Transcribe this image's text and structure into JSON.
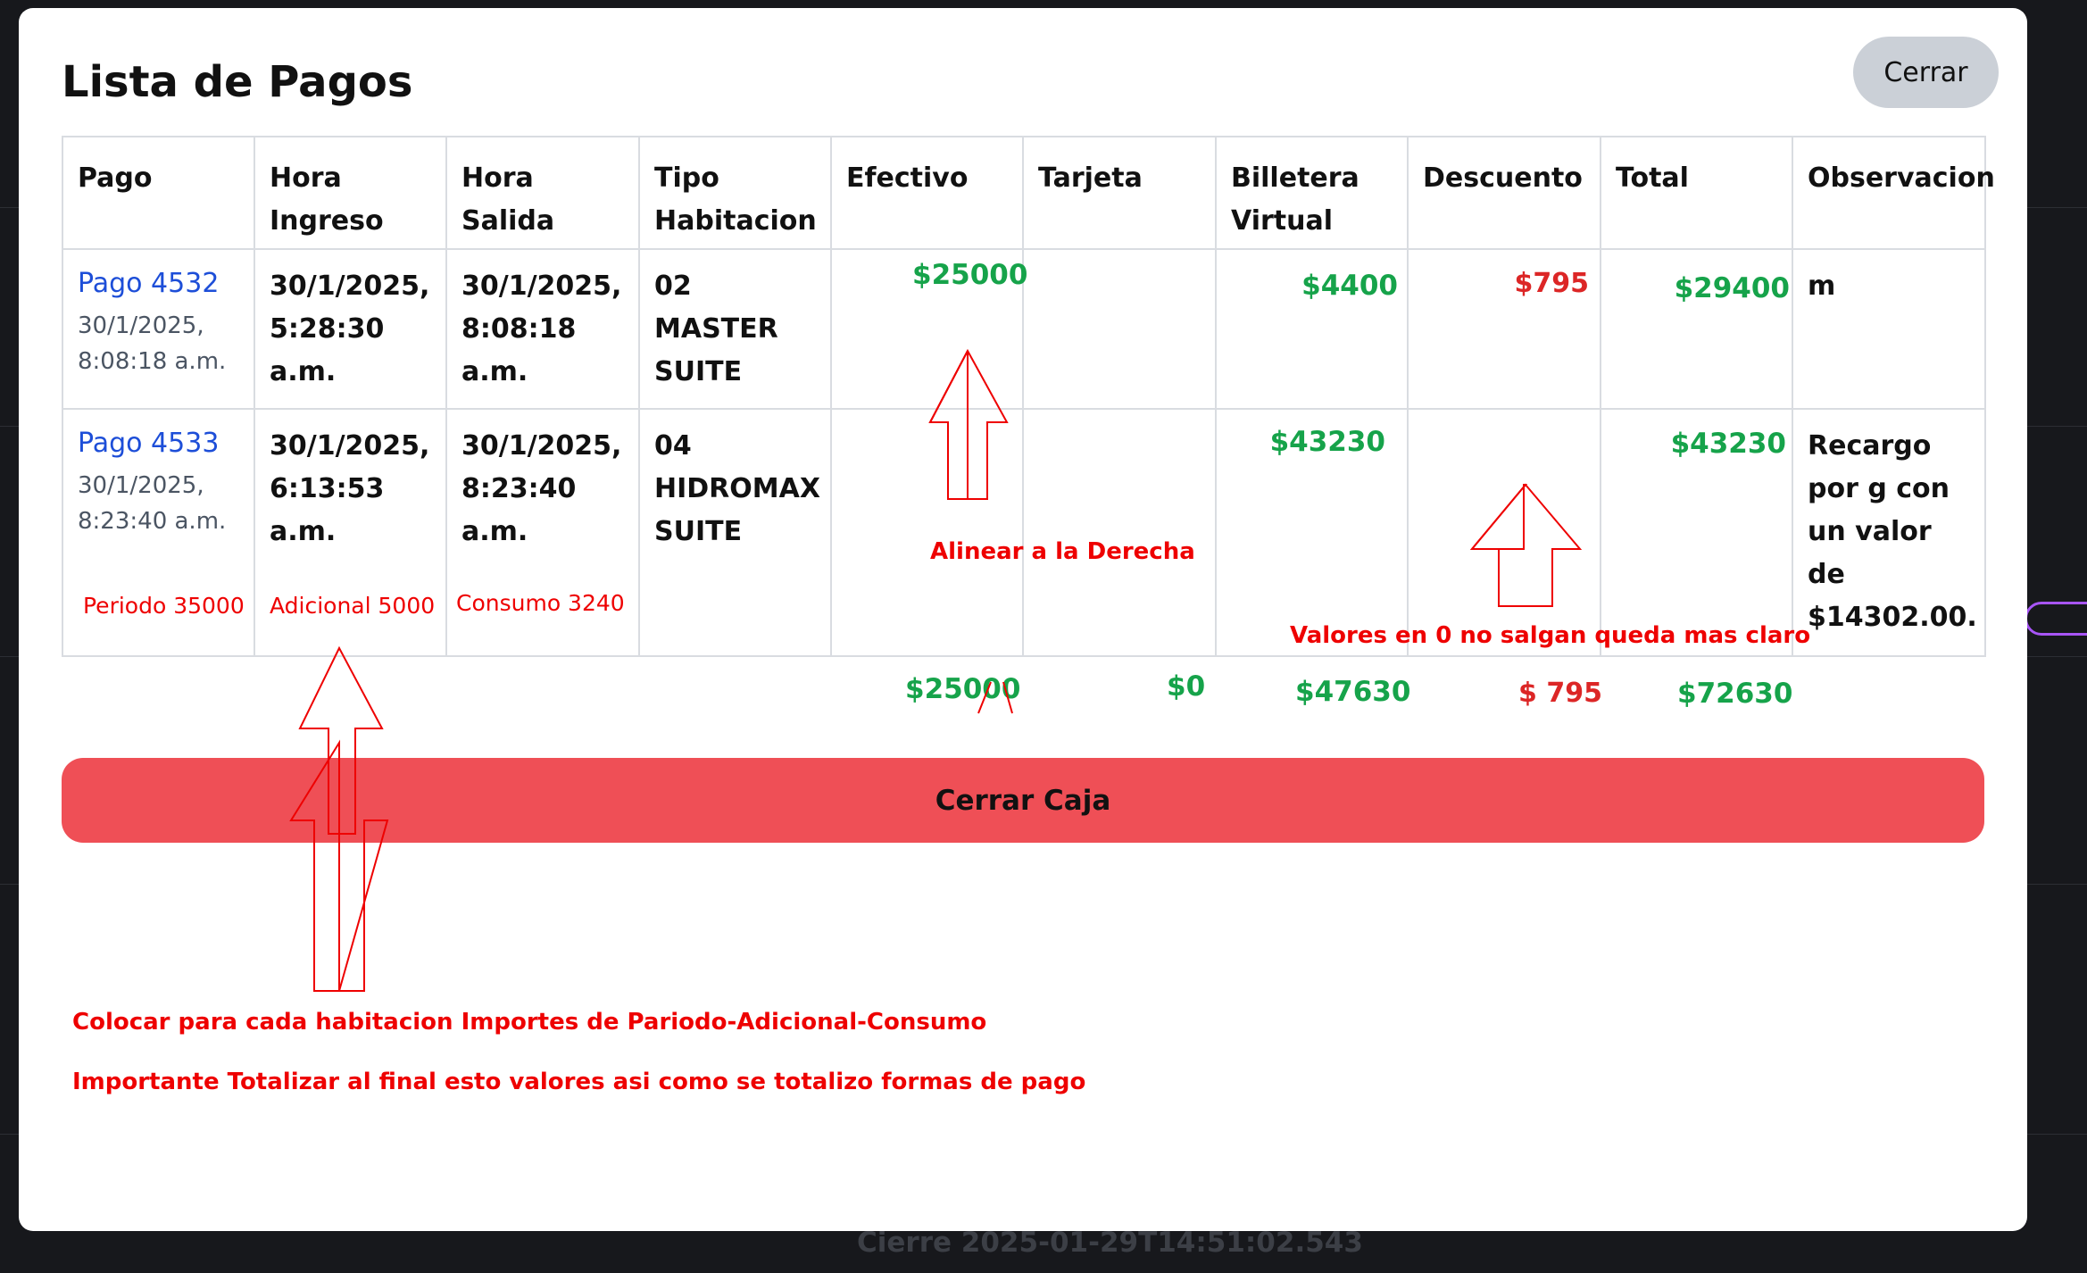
{
  "modal": {
    "title": "Lista de Pagos",
    "close_label": "Cerrar",
    "submit_label": "Cerrar Caja"
  },
  "table": {
    "headers": {
      "pago": "Pago",
      "hora_ingreso": "Hora Ingreso",
      "hora_salida": "Hora Salida",
      "tipo": "Tipo Habitacion",
      "efectivo": "Efectivo",
      "tarjeta": "Tarjeta",
      "billetera": "Billetera Virtual",
      "descuento": "Descuento",
      "total": "Total",
      "observacion": "Observacion"
    },
    "rows": [
      {
        "pago": "Pago 4532",
        "pago_fecha_1": "30/1/2025,",
        "pago_fecha_2": "8:08:18 a.m.",
        "ingreso_1": "30/1/2025,",
        "ingreso_2": "5:28:30",
        "ingreso_3": "a.m.",
        "salida_1": "30/1/2025,",
        "salida_2": "8:08:18",
        "salida_3": "a.m.",
        "tipo_1": "02",
        "tipo_2": "MASTER",
        "tipo_3": "SUITE",
        "efectivo": "$25000",
        "billetera": "$4400",
        "descuento": "$795",
        "total": "$29400",
        "observacion": "m"
      },
      {
        "pago": "Pago 4533",
        "pago_fecha_1": "30/1/2025,",
        "pago_fecha_2": "8:23:40 a.m.",
        "ingreso_1": "30/1/2025,",
        "ingreso_2": "6:13:53",
        "ingreso_3": "a.m.",
        "salida_1": "30/1/2025,",
        "salida_2": "8:23:40",
        "salida_3": "a.m.",
        "tipo_1": "04",
        "tipo_2": "HIDROMAX",
        "tipo_3": "SUITE",
        "billetera": "$43230",
        "total": "$43230",
        "obs_1": "Recargo",
        "obs_2": "por g con",
        "obs_3": "un valor",
        "obs_4": "de",
        "obs_5": "$14302.00.",
        "note_periodo": "Periodo 35000",
        "note_adicional": "Adicional 5000",
        "note_consumo": "Consumo 3240"
      }
    ],
    "totals": {
      "efectivo": "$25000",
      "tarjeta": "$0",
      "billetera": "$47630",
      "descuento": "$ 795",
      "total": "$72630"
    }
  },
  "annotations": {
    "alinear": "Alinear a la Derecha",
    "valores_cero": "Valores en 0 no salgan queda mas claro",
    "colocar": "Colocar para cada habitacion Importes de Pariodo-Adicional-Consumo",
    "importante": "Importante Totalizar al final esto valores asi como se totalizo formas de pago"
  },
  "background": {
    "footer_text": "Cierre 2025-01-29T14:51:02.543"
  },
  "colors": {
    "link": "#1d4ed8",
    "amount_green": "#16a34a",
    "amount_red": "#dc2626",
    "annotation_red": "#ee0000",
    "submit_button": "#ef4f56",
    "close_button": "#cbd0d7"
  }
}
